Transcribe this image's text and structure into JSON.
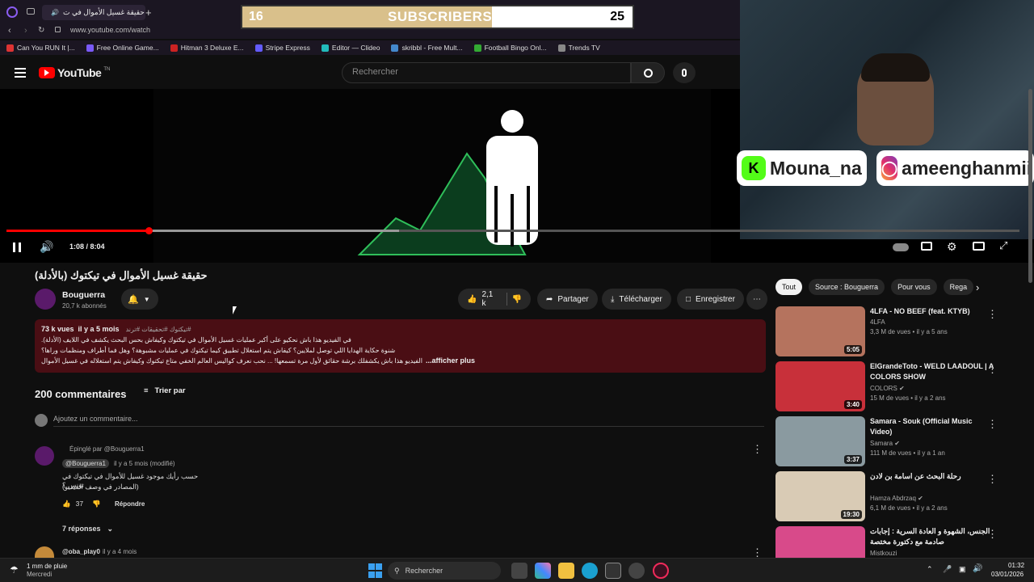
{
  "browser": {
    "tab_active": "حقيقة غسيل الأموال في ت",
    "url": "www.youtube.com/watch",
    "bookmarks": [
      {
        "label": "Can You RUN It |...",
        "color": "#d33"
      },
      {
        "label": "Free Online Game...",
        "color": "#7a5af8"
      },
      {
        "label": "Hitman 3 Deluxe E...",
        "color": "#c22"
      },
      {
        "label": "Stripe Express",
        "color": "#635bff"
      },
      {
        "label": "Editor — Clideo",
        "color": "#2bb"
      },
      {
        "label": "skribbl - Free Mult...",
        "color": "#48c"
      },
      {
        "label": "Football Bingo Onl...",
        "color": "#3a3"
      },
      {
        "label": "Trends TV",
        "color": "#888"
      }
    ]
  },
  "youtube": {
    "logo": "YouTube",
    "logo_sup": "TN",
    "search_placeholder": "Rechercher"
  },
  "overlay": {
    "sub_current": "16",
    "sub_label": "SUBSCRIBERS",
    "sub_goal": "25",
    "sub_progress": 0.64,
    "handle1": "Mouna_na",
    "handle2": "ameenghanmii"
  },
  "player": {
    "time": "1:08 / 8:04",
    "progress": 0.14
  },
  "video": {
    "title": "حقيقة غسيل الأموال في تيكتوك (بالأدلة)",
    "channel": "Bouguerra",
    "subscribers": "20,7 k abonnés",
    "likes": "2,1 k",
    "share": "Partager",
    "download": "Télécharger",
    "save": "Enregistrer"
  },
  "description": {
    "meta": "73 k vues  il y a 5 mois",
    "tags": "#تيكتوك #تحقيقات #ترند",
    "line1": "في الفيديو هذا باش نحكيو على أكبر عمليات غسيل الأموال في تيكتوك وكيفاش بحس البحث يكشف في اللايف (الأدلة).",
    "line2": "شنوة حكاية الهدايا اللي توصل لملايين؟ كيفاش يتم استغلال تطبيق كيما تيكتوك في عمليات مشبوهة؟ وهل فما أطراف ومنظمات وراها؟",
    "line3": "الفيديو هذا باش يكشفلك برشة حقائق لأول مرة تسمعها! ... نحب نعرف كواليس العالم الخفي متاع تيكتوك وكيفاش يتم استغلاله في غسيل الأموال",
    "more": "...afficher plus"
  },
  "comments": {
    "count": "200 commentaires",
    "sort": "Trier par",
    "add_placeholder": "Ajoutez un commentaire...",
    "pinned_label": "Épinglé par @Bouguerra1",
    "author": "@Bouguerra1",
    "time": "il y a 5 mois (modifié)",
    "text1": "حسب رأيك موجود غسيل للأموال في تيكتوك في تونس ؟",
    "text2": "(المصادر في وصف الفيديو)",
    "likes": "37",
    "reply": "Répondre",
    "replies": "7 réponses",
    "next_author": "@oba_play0",
    "next_time": "il y a 4 mois"
  },
  "filters": [
    "Tout",
    "Source : Bouguerra",
    "Pour vous",
    "Rega"
  ],
  "sidebar": [
    {
      "title": "4LFA - NO BEEF (feat. KTYB)",
      "channel": "4LFA",
      "meta": "3,3 M de vues • il y a 5 ans",
      "duration": "5:05",
      "bg": "#b5735e",
      "verified": false
    },
    {
      "title": "ElGrandeToto - WELD LAADOUL | A COLORS SHOW",
      "channel": "COLORS",
      "meta": "15 M de vues • il y a 2 ans",
      "duration": "3:40",
      "bg": "#c8303a",
      "verified": true
    },
    {
      "title": "Samara - Souk (Official Music Video)",
      "channel": "Samara",
      "meta": "111 M de vues • il y a 1 an",
      "duration": "3:37",
      "bg": "#8a9aa0",
      "verified": true
    },
    {
      "title": "رحلة البحث عن اسامة بن لادن",
      "channel": "Hamza Abdrzaq",
      "meta": "6,1 M de vues • il y a 2 ans",
      "duration": "19:30",
      "bg": "#d9cbb5",
      "verified": true
    },
    {
      "title": "الجنس، الشهوة و العادة السرية : إجابات صادمة مع دكتورة مختصة",
      "channel": "Mistkouzi",
      "meta": "",
      "duration": "",
      "bg": "#d84a8a",
      "verified": false
    }
  ],
  "taskbar": {
    "weather": "1 mm de pluie",
    "weather_day": "Mercredi",
    "search": "Rechercher",
    "time": "01:32",
    "date": "03/01/2026"
  }
}
